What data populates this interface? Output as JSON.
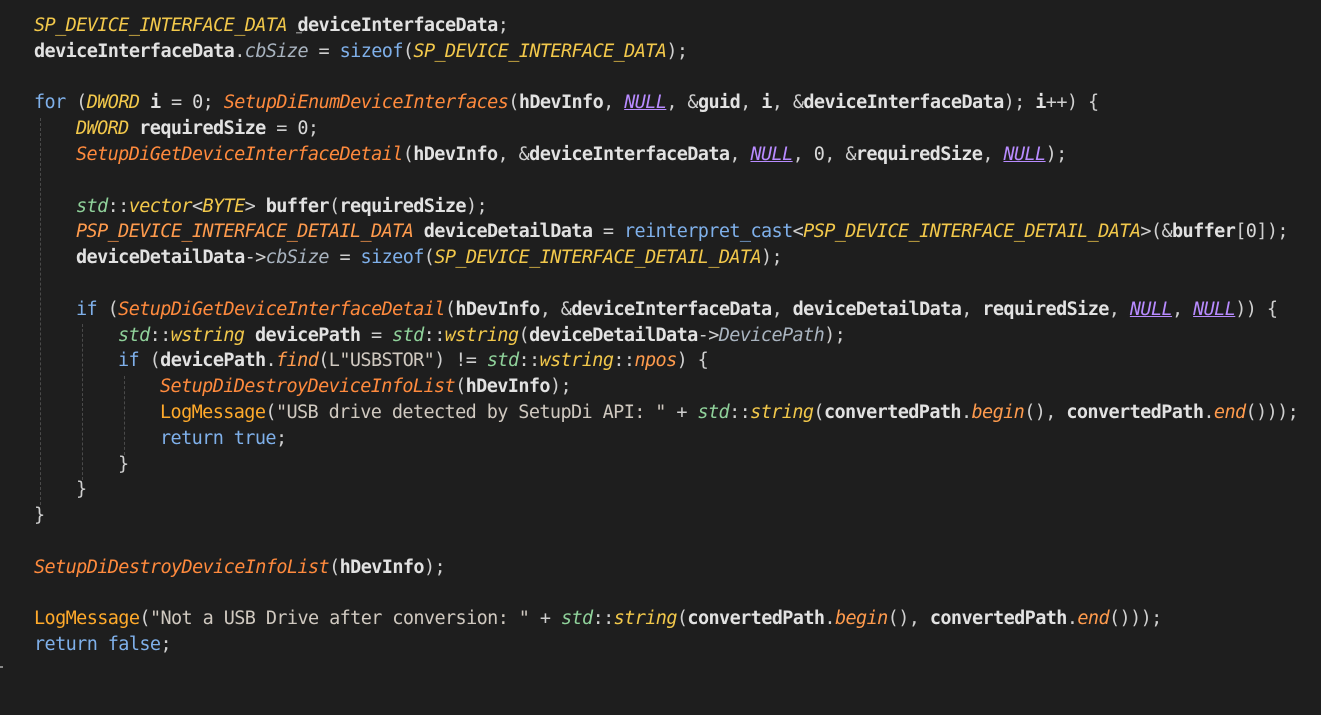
{
  "editor": {
    "language": "cpp",
    "colors": {
      "background": "#1e1e1e",
      "type": "#f2c84b",
      "function": "#ff8a3d",
      "variable": "#e2e2e2",
      "keyword": "#7fb0ea",
      "macro": "#b88bff",
      "namespace": "#8fd19a"
    },
    "lines": [
      [
        [
          "typ",
          "SP_DEVICE_INTERFACE_DATA"
        ],
        [
          "var",
          " deviceInterfaceData"
        ],
        [
          "punc",
          ";"
        ]
      ],
      [
        [
          "var",
          "deviceInterfaceData"
        ],
        [
          "punc",
          "."
        ],
        [
          "mem2",
          "cbSize"
        ],
        [
          "punc",
          " = "
        ],
        [
          "kw",
          "sizeof"
        ],
        [
          "punc",
          "("
        ],
        [
          "typ",
          "SP_DEVICE_INTERFACE_DATA"
        ],
        [
          "punc",
          ");"
        ]
      ],
      [],
      [
        [
          "kw",
          "for"
        ],
        [
          "punc",
          " ("
        ],
        [
          "typ",
          "DWORD"
        ],
        [
          "var",
          " i"
        ],
        [
          "punc",
          " = "
        ],
        [
          "num",
          "0"
        ],
        [
          "punc",
          "; "
        ],
        [
          "fn",
          "SetupDiEnumDeviceInterfaces"
        ],
        [
          "punc",
          "("
        ],
        [
          "var",
          "hDevInfo"
        ],
        [
          "punc",
          ", "
        ],
        [
          "mac",
          "NULL"
        ],
        [
          "punc",
          ", &"
        ],
        [
          "var",
          "guid"
        ],
        [
          "punc",
          ", "
        ],
        [
          "var",
          "i"
        ],
        [
          "punc",
          ", &"
        ],
        [
          "var",
          "deviceInterfaceData"
        ],
        [
          "punc",
          "); "
        ],
        [
          "var",
          "i"
        ],
        [
          "punc",
          "++) {"
        ]
      ],
      [
        [
          "typ",
          "DWORD"
        ],
        [
          "var",
          " requiredSize"
        ],
        [
          "punc",
          " = "
        ],
        [
          "num",
          "0"
        ],
        [
          "punc",
          ";"
        ]
      ],
      [
        [
          "fn",
          "SetupDiGetDeviceInterfaceDetail"
        ],
        [
          "punc",
          "("
        ],
        [
          "var",
          "hDevInfo"
        ],
        [
          "punc",
          ", &"
        ],
        [
          "var",
          "deviceInterfaceData"
        ],
        [
          "punc",
          ", "
        ],
        [
          "mac",
          "NULL"
        ],
        [
          "punc",
          ", "
        ],
        [
          "num",
          "0"
        ],
        [
          "punc",
          ", &"
        ],
        [
          "var",
          "requiredSize"
        ],
        [
          "punc",
          ", "
        ],
        [
          "mac",
          "NULL"
        ],
        [
          "punc",
          ");"
        ]
      ],
      [],
      [
        [
          "ns",
          "std"
        ],
        [
          "punc",
          "::"
        ],
        [
          "typ",
          "vector"
        ],
        [
          "punc",
          "<"
        ],
        [
          "typ",
          "BYTE"
        ],
        [
          "punc",
          "> "
        ],
        [
          "var",
          "buffer"
        ],
        [
          "punc",
          "("
        ],
        [
          "var",
          "requiredSize"
        ],
        [
          "punc",
          ");"
        ]
      ],
      [
        [
          "mem",
          "PSP_DEVICE_INTERFACE_DETAIL_DATA"
        ],
        [
          "var",
          " deviceDetailData"
        ],
        [
          "punc",
          " = "
        ],
        [
          "kw",
          "reinterpret_cast"
        ],
        [
          "punc",
          "<"
        ],
        [
          "typ",
          "PSP_DEVICE_INTERFACE_DETAIL_DATA"
        ],
        [
          "punc",
          ">(&"
        ],
        [
          "var",
          "buffer"
        ],
        [
          "punc",
          "["
        ],
        [
          "num",
          "0"
        ],
        [
          "punc",
          "]);"
        ]
      ],
      [
        [
          "var",
          "deviceDetailData"
        ],
        [
          "punc",
          "->"
        ],
        [
          "mem2",
          "cbSize"
        ],
        [
          "punc",
          " = "
        ],
        [
          "kw",
          "sizeof"
        ],
        [
          "punc",
          "("
        ],
        [
          "typ",
          "SP_DEVICE_INTERFACE_DETAIL_DATA"
        ],
        [
          "punc",
          ");"
        ]
      ],
      [],
      [
        [
          "kw",
          "if"
        ],
        [
          "punc",
          " ("
        ],
        [
          "fn",
          "SetupDiGetDeviceInterfaceDetail"
        ],
        [
          "punc",
          "("
        ],
        [
          "var",
          "hDevInfo"
        ],
        [
          "punc",
          ", &"
        ],
        [
          "var",
          "deviceInterfaceData"
        ],
        [
          "punc",
          ", "
        ],
        [
          "var",
          "deviceDetailData"
        ],
        [
          "punc",
          ", "
        ],
        [
          "var",
          "requiredSize"
        ],
        [
          "punc",
          ", "
        ],
        [
          "mac",
          "NULL"
        ],
        [
          "punc",
          ", "
        ],
        [
          "mac",
          "NULL"
        ],
        [
          "punc",
          ")) {"
        ]
      ],
      [
        [
          "ns",
          "std"
        ],
        [
          "punc",
          "::"
        ],
        [
          "typ",
          "wstring"
        ],
        [
          "var",
          " devicePath"
        ],
        [
          "punc",
          " = "
        ],
        [
          "ns",
          "std"
        ],
        [
          "punc",
          "::"
        ],
        [
          "typ",
          "wstring"
        ],
        [
          "punc",
          "("
        ],
        [
          "var",
          "deviceDetailData"
        ],
        [
          "punc",
          "->"
        ],
        [
          "mem2",
          "DevicePath"
        ],
        [
          "punc",
          ");"
        ]
      ],
      [
        [
          "kw",
          "if"
        ],
        [
          "punc",
          " ("
        ],
        [
          "var",
          "devicePath"
        ],
        [
          "punc",
          "."
        ],
        [
          "mem",
          "find"
        ],
        [
          "punc",
          "("
        ],
        [
          "str",
          "L\"USBSTOR\""
        ],
        [
          "punc",
          ") != "
        ],
        [
          "ns",
          "std"
        ],
        [
          "punc",
          "::"
        ],
        [
          "typ",
          "wstring"
        ],
        [
          "punc",
          "::"
        ],
        [
          "mem",
          "npos"
        ],
        [
          "punc",
          ") {"
        ]
      ],
      [
        [
          "fn",
          "SetupDiDestroyDeviceInfoList"
        ],
        [
          "punc",
          "("
        ],
        [
          "var",
          "hDevInfo"
        ],
        [
          "punc",
          ");"
        ]
      ],
      [
        [
          "fnc",
          "LogMessage"
        ],
        [
          "punc",
          "("
        ],
        [
          "str",
          "\"USB drive detected by SetupDi API: \""
        ],
        [
          "punc",
          " + "
        ],
        [
          "ns",
          "std"
        ],
        [
          "punc",
          "::"
        ],
        [
          "typ",
          "string"
        ],
        [
          "punc",
          "("
        ],
        [
          "var",
          "convertedPath"
        ],
        [
          "punc",
          "."
        ],
        [
          "mem",
          "begin"
        ],
        [
          "punc",
          "(), "
        ],
        [
          "var",
          "convertedPath"
        ],
        [
          "punc",
          "."
        ],
        [
          "mem",
          "end"
        ],
        [
          "punc",
          "()));"
        ]
      ],
      [
        [
          "kw",
          "return"
        ],
        [
          "kw",
          " true"
        ],
        [
          "punc",
          ";"
        ]
      ],
      [
        [
          "punc",
          "}"
        ]
      ],
      [
        [
          "punc",
          "}"
        ]
      ],
      [
        [
          "punc",
          "}"
        ]
      ],
      [],
      [
        [
          "fn",
          "SetupDiDestroyDeviceInfoList"
        ],
        [
          "punc",
          "("
        ],
        [
          "var",
          "hDevInfo"
        ],
        [
          "punc",
          ");"
        ]
      ],
      [],
      [
        [
          "fnc",
          "LogMessage"
        ],
        [
          "punc",
          "("
        ],
        [
          "str",
          "\"Not a USB Drive after conversion: \""
        ],
        [
          "punc",
          " + "
        ],
        [
          "ns",
          "std"
        ],
        [
          "punc",
          "::"
        ],
        [
          "typ",
          "string"
        ],
        [
          "punc",
          "("
        ],
        [
          "var",
          "convertedPath"
        ],
        [
          "punc",
          "."
        ],
        [
          "mem",
          "begin"
        ],
        [
          "punc",
          "(), "
        ],
        [
          "var",
          "convertedPath"
        ],
        [
          "punc",
          "."
        ],
        [
          "mem",
          "end"
        ],
        [
          "punc",
          "()));"
        ]
      ],
      [
        [
          "kw",
          "return"
        ],
        [
          "kw",
          " false"
        ],
        [
          "punc",
          ";"
        ]
      ]
    ]
  }
}
